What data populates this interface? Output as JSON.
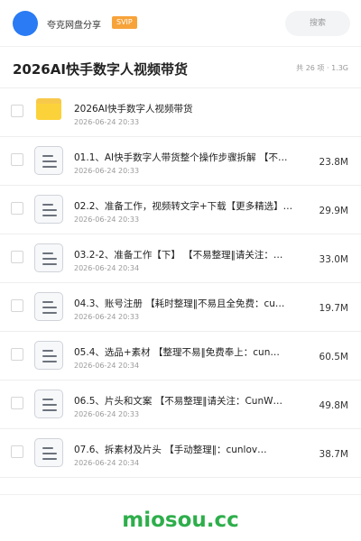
{
  "header": {
    "site_name": "夸克网盘分享",
    "badge": "SVIP",
    "search_placeholder": "搜索",
    "brand_color": "#2a7bf4",
    "badge_color": "#f7a33a"
  },
  "title_bar": {
    "title": "2026AI快手数字人视频带货",
    "meta": "共 26 项 · 1.3G"
  },
  "files": [
    {
      "type": "folder",
      "name": "2026AI快手数字人视频带货",
      "date": "2026-06-24 20:33",
      "size": ""
    },
    {
      "type": "file",
      "name": "01.1、AI快手数字人带货整个操作步骤拆解 【不…",
      "date": "2026-06-24 20:33",
      "size": "23.8M"
    },
    {
      "type": "file",
      "name": "02.2、准备工作，视频转文字+下载【更多精选】…",
      "date": "2026-06-24 20:33",
      "size": "29.9M"
    },
    {
      "type": "file",
      "name": "03.2-2、准备工作【下】 【不易整理‖请关注：…",
      "date": "2026-06-24 20:34",
      "size": "33.0M"
    },
    {
      "type": "file",
      "name": "04.3、账号注册 【耗时整理‖不易且全免费：cu…",
      "date": "2026-06-24 20:33",
      "size": "19.7M"
    },
    {
      "type": "file",
      "name": "05.4、选品+素材 【整理不易‖免费奉上：cun…",
      "date": "2026-06-24 20:34",
      "size": "60.5M"
    },
    {
      "type": "file",
      "name": "06.5、片头和文案 【不易整理‖请关注：CunW…",
      "date": "2026-06-24 20:33",
      "size": "49.8M"
    },
    {
      "type": "file",
      "name": "07.6、拆素材及片头 【手动整理‖：cunlov…",
      "date": "2026-06-24 20:34",
      "size": "38.7M"
    }
  ],
  "watermark": "miosou.cc"
}
